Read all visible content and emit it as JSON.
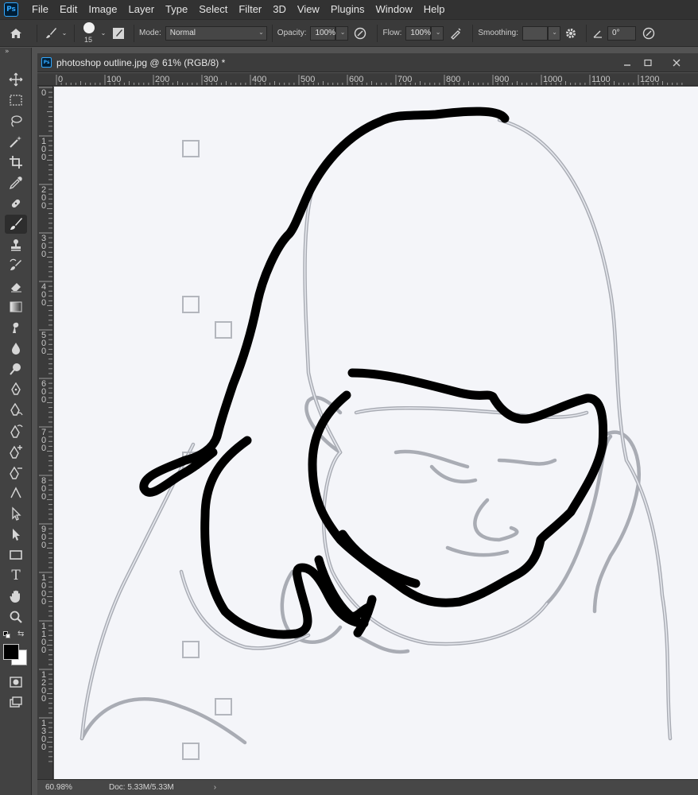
{
  "menu": {
    "app_logo": "Ps",
    "items": [
      "File",
      "Edit",
      "Image",
      "Layer",
      "Type",
      "Select",
      "Filter",
      "3D",
      "View",
      "Plugins",
      "Window",
      "Help"
    ]
  },
  "options": {
    "brush_size": "15",
    "mode_label": "Mode:",
    "mode_value": "Normal",
    "opacity_label": "Opacity:",
    "opacity_value": "100%",
    "flow_label": "Flow:",
    "flow_value": "100%",
    "smoothing_label": "Smoothing:",
    "smoothing_value": "",
    "angle_label": "0°"
  },
  "document": {
    "tab_logo": "Ps",
    "title": "photoshop outline.jpg @ 61% (RGB/8) *",
    "ruler_h_labels": [
      "0",
      "100",
      "200",
      "300",
      "400",
      "500",
      "600",
      "700",
      "800",
      "900",
      "1000",
      "1100",
      "1200"
    ],
    "ruler_v_labels": [
      "0",
      "100",
      "200",
      "300",
      "400",
      "500",
      "600",
      "700",
      "800",
      "900",
      "1000",
      "1100",
      "1200",
      "1300"
    ]
  },
  "status": {
    "zoom": "60.98%",
    "doc_size": "Doc: 5.33M/5.33M",
    "arrow": "›"
  },
  "icons": {
    "home": "home-icon",
    "brush": "brush-icon",
    "window_minimize": "minimize-icon",
    "window_maximize": "maximize-icon",
    "window_close": "close-icon"
  },
  "colors": {
    "foreground": "#000000",
    "background": "#ffffff",
    "accent": "#31a8ff"
  }
}
